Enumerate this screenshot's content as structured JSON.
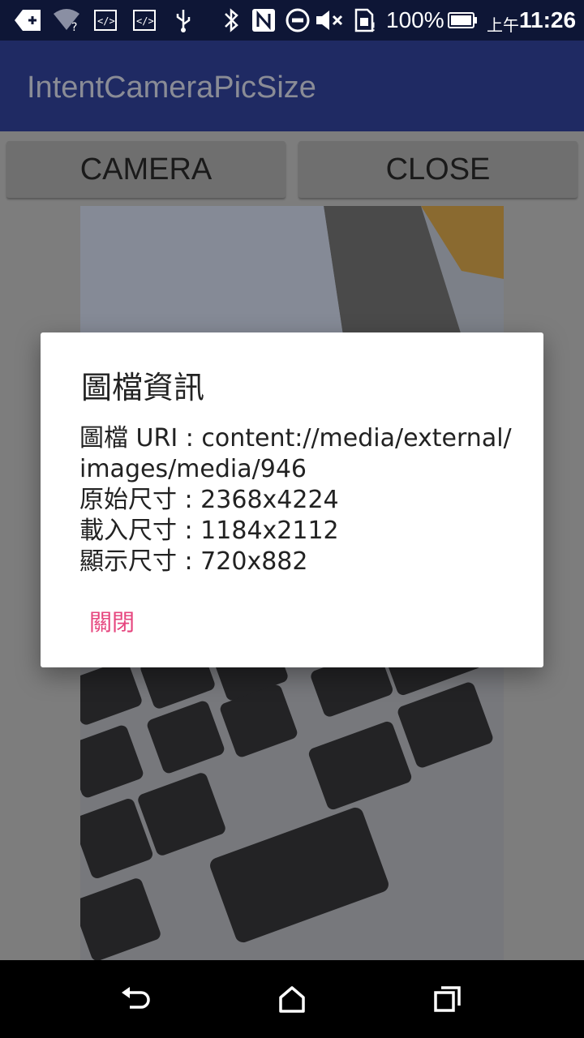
{
  "status_bar": {
    "battery_percent": "100%",
    "ampm": "上午",
    "time": "11:26",
    "icons": [
      "add-notification-icon",
      "wifi-question-icon",
      "code-icon",
      "code-icon",
      "usb-icon",
      "bluetooth-icon",
      "nfc-icon",
      "do-not-disturb-icon",
      "mute-icon",
      "sim-icon",
      "battery-icon"
    ]
  },
  "app_bar": {
    "title": "IntentCameraPicSize"
  },
  "buttons": {
    "camera": "CAMERA",
    "close": "CLOSE"
  },
  "dialog": {
    "title": "圖檔資訊",
    "lines": [
      "圖檔 URI : content://media/external/",
      "images/media/946",
      "原始尺寸 : 2368x4224",
      "載入尺寸 : 1184x2112",
      "顯示尺寸 : 720x882"
    ],
    "dismiss_label": "關閉",
    "accent_color": "#E6457E"
  },
  "nav_bar": {
    "icons": [
      "back-icon",
      "home-icon",
      "recents-icon"
    ]
  }
}
